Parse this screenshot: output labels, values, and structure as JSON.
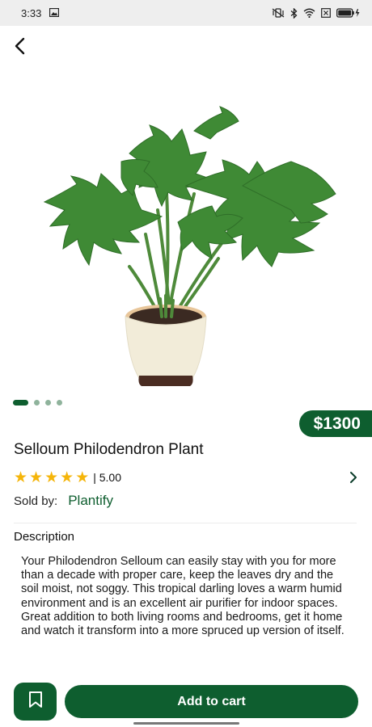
{
  "status_bar": {
    "time": "3:33"
  },
  "product": {
    "title": "Selloum Philodendron Plant",
    "price": "$1300",
    "rating_text": "| 5.00",
    "rating_value": 5,
    "sold_by_label": "Sold by:",
    "seller": "Plantify",
    "carousel": {
      "total": 4,
      "active_index": 0
    }
  },
  "description": {
    "heading": "Description",
    "body": "Your Philodendron Selloum can easily stay with you for more than a decade with proper care, keep the leaves dry and the soil moist, not soggy. This tropical darling loves a warm humid environment and is an excellent air purifier for indoor spaces. Great addition to both living rooms and bedrooms, get it home and watch it transform into a more spruced up version of itself."
  },
  "actions": {
    "add_to_cart_label": "Add to cart"
  },
  "icons": {
    "back": "chevron-left-icon",
    "bookmark": "bookmark-icon",
    "rating_chevron": "chevron-right-icon"
  },
  "colors": {
    "brand_green": "#0e5e2f",
    "star_yellow": "#f5b50a",
    "inactive_dot": "#8fb39c"
  }
}
